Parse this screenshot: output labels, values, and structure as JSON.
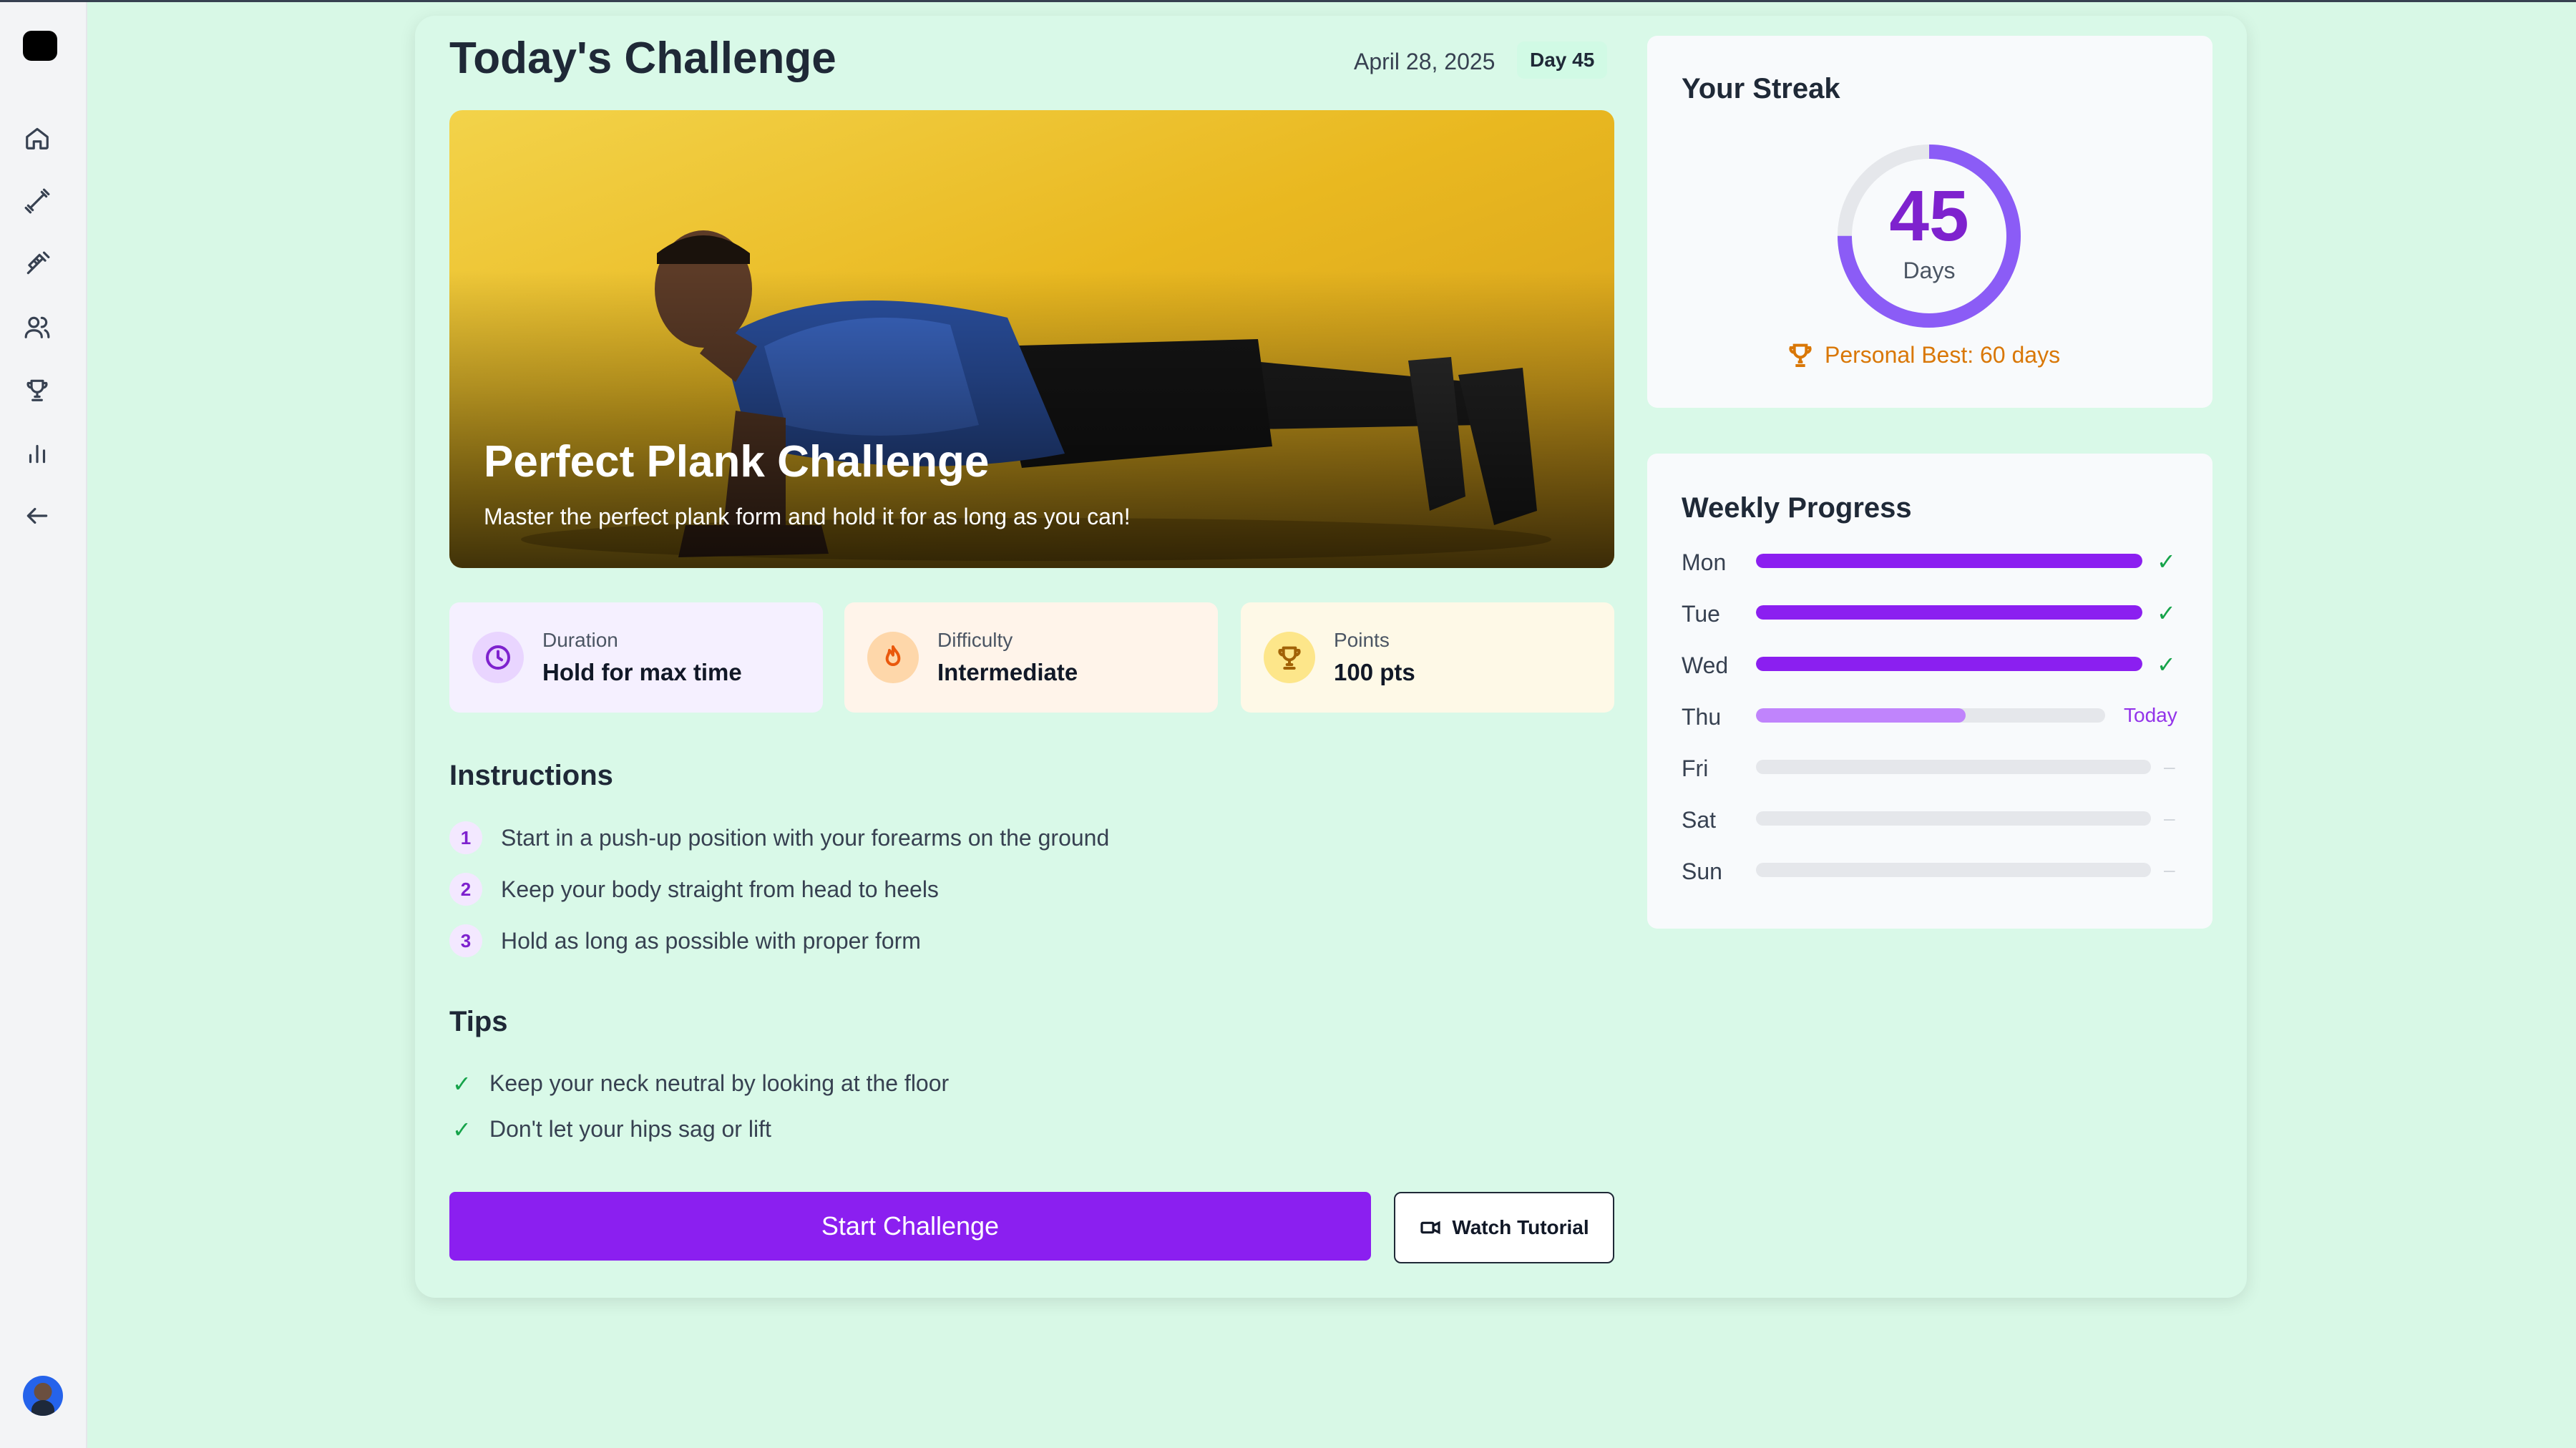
{
  "header": {
    "title": "Today's Challenge",
    "date": "April 28, 2025",
    "day_badge": "Day 45"
  },
  "sidebar": {
    "items": [
      {
        "icon": "home-icon"
      },
      {
        "icon": "dumbbell-icon"
      },
      {
        "icon": "syringe-icon"
      },
      {
        "icon": "users-icon"
      },
      {
        "icon": "trophy-icon"
      },
      {
        "icon": "bar-chart-icon"
      },
      {
        "icon": "arrow-left-icon"
      }
    ]
  },
  "hero": {
    "title": "Perfect Plank Challenge",
    "subtitle": "Master the perfect plank form and hold it for as long as you can!"
  },
  "stats": [
    {
      "label": "Duration",
      "value": "Hold for max time",
      "icon": "clock-icon",
      "color": "#7e22ce"
    },
    {
      "label": "Difficulty",
      "value": "Intermediate",
      "icon": "flame-icon",
      "color": "#ea580c"
    },
    {
      "label": "Points",
      "value": "100 pts",
      "icon": "trophy-icon",
      "color": "#ca8a04"
    }
  ],
  "instructions": {
    "title": "Instructions",
    "steps": [
      {
        "num": "1",
        "text": "Start in a push-up position with your forearms on the ground"
      },
      {
        "num": "2",
        "text": "Keep your body straight from head to heels"
      },
      {
        "num": "3",
        "text": "Hold as long as possible with proper form"
      }
    ]
  },
  "tips": {
    "title": "Tips",
    "items": [
      {
        "check": "✓",
        "text": "Keep your neck neutral by looking at the floor"
      },
      {
        "check": "✓",
        "text": "Don't let your hips sag or lift"
      }
    ]
  },
  "actions": {
    "start": "Start Challenge",
    "tutorial": "Watch Tutorial"
  },
  "streak": {
    "title": "Your Streak",
    "days": "45",
    "days_label": "Days",
    "progress_fraction": 0.75,
    "personal_best": "Personal Best: 60 days"
  },
  "weekly": {
    "title": "Weekly Progress",
    "days": [
      {
        "day": "Mon",
        "progress": 1.0,
        "status": "✓"
      },
      {
        "day": "Tue",
        "progress": 1.0,
        "status": "✓"
      },
      {
        "day": "Wed",
        "progress": 1.0,
        "status": "✓"
      },
      {
        "day": "Thu",
        "progress": 0.6,
        "status": "Today"
      },
      {
        "day": "Fri",
        "progress": 0,
        "status": "–"
      },
      {
        "day": "Sat",
        "progress": 0,
        "status": "–"
      },
      {
        "day": "Sun",
        "progress": 0,
        "status": "–"
      }
    ]
  },
  "colors": {
    "accent": "#8b1ff0",
    "background": "#d8f8e6",
    "success": "#16a34a",
    "gold": "#d97706"
  }
}
